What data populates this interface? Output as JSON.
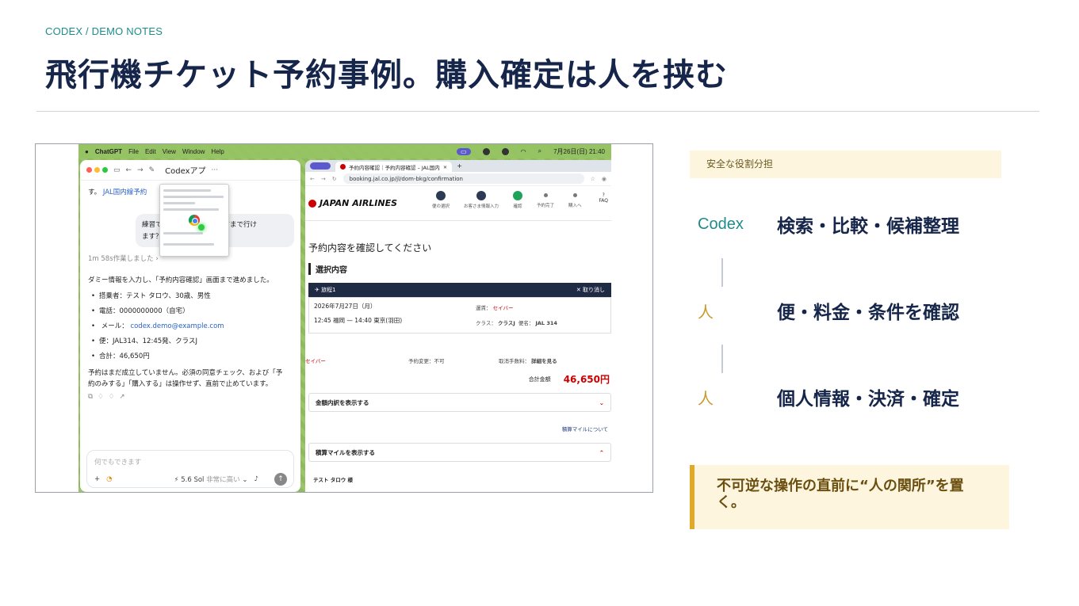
{
  "slide": {
    "eyebrow": "CODEX / DEMO NOTES",
    "title": "飛行機チケット予約事例。購入確定は人を挟む"
  },
  "screenshot": {
    "menubar": {
      "app": "ChatGPT",
      "items": [
        "File",
        "Edit",
        "View",
        "Window",
        "Help"
      ],
      "clock": "7月26日(日) 21:40"
    },
    "codex": {
      "window_title": "Codexアプ",
      "intro_line": "す。",
      "intro_link": "JAL国内線予約",
      "user_bubble_line1": "練習で",
      "user_bubble_line1_end": "の手前まで行け",
      "user_bubble_line2": "ます？",
      "worked": "1m 58s作業しました",
      "summary": "ダミー情報を入力し、「予約内容確認」画面まで進めました。",
      "bullets": [
        "搭乗者：テスト タロウ、30歳、男性",
        "電話：0000000000（自宅）",
        "メール：",
        "便：JAL314、12:45発、クラスJ",
        "合計：46,650円"
      ],
      "email": "codex.demo@example.com",
      "footer_line1": "予約はまだ成立していません。必須の同意チェック、および「予",
      "footer_line2": "約のみする」「購入する」は操作せず、直前で止めています。",
      "composer_placeholder": "何でもできます",
      "model_label": "5.6 Sol",
      "effort_label": "非常に高い"
    },
    "browser": {
      "tab_title": "予約内容確認｜予約内容確認 – JAL国内",
      "url": "booking.jal.co.jp/jl/dom-bkg/confirmation",
      "airline": "JAPAN AIRLINES",
      "steps": [
        "便の選択",
        "お客さま情報入力",
        "確認",
        "予約完了",
        "購入へ"
      ],
      "faq": "FAQ",
      "heading": "予約内容を確認してください",
      "section": "選択内容",
      "trip_label": "旅程1",
      "cancel": "取り消し",
      "date": "2026年7月27日（月）",
      "dep": "12:45 福岡",
      "arr": "14:40 東京(羽田)",
      "fare_type_label": "運賃：",
      "fare_type": "セイバー",
      "class_label": "クラス：",
      "class": "クラスJ",
      "flight_label": "便名：",
      "flight": "JAL 314",
      "fare_name": "セイバー",
      "change": "予約変更：不可",
      "cancel_fee_label": "取消手数料：",
      "cancel_fee": "詳細を見る",
      "total_label": "合計金額",
      "total": "46,650円",
      "acc_breakdown": "金額内訳を表示する",
      "mile_link": "積算マイルについて",
      "acc_miles": "積算マイルを表示する",
      "passenger": "テスト タロウ 様"
    }
  },
  "panel": {
    "tag": "安全な役割分担",
    "roles": [
      {
        "actor": "Codex",
        "task": "検索・比較・候補整理"
      },
      {
        "actor": "人",
        "task": "便・料金・条件を確認"
      },
      {
        "actor": "人",
        "task": "個人情報・決済・確定"
      }
    ],
    "note": "不可逆な操作の直前に“人の関所”を置く。"
  }
}
